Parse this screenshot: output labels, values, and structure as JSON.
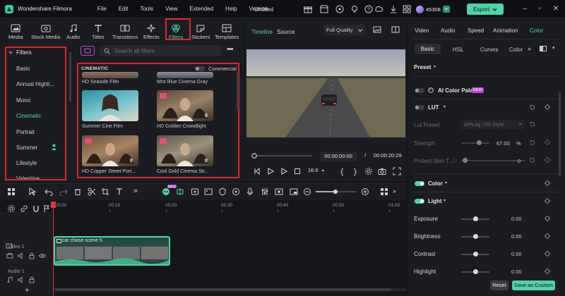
{
  "titlebar": {
    "app_name": "Wondershare Filmora",
    "menu": [
      "File",
      "Edit",
      "Tools",
      "View",
      "Extended",
      "Help",
      "Version"
    ],
    "project_title": "Untitled",
    "credits": "45308",
    "export_label": "Export"
  },
  "media_toolbar": {
    "tabs": [
      {
        "label": "Media",
        "icon": "media-icon"
      },
      {
        "label": "Stock Media",
        "icon": "stock-media-icon"
      },
      {
        "label": "Audio",
        "icon": "music-note-icon"
      },
      {
        "label": "Titles",
        "icon": "text-icon"
      },
      {
        "label": "Transitions",
        "icon": "transitions-icon"
      },
      {
        "label": "Effects",
        "icon": "sparkle-icon"
      },
      {
        "label": "Filters",
        "icon": "filters-icon"
      },
      {
        "label": "Stickers",
        "icon": "sticker-icon"
      },
      {
        "label": "Templates",
        "icon": "templates-icon"
      }
    ],
    "active_tab": "Filters"
  },
  "filters_panel": {
    "header": "Filters",
    "categories": [
      "Basic",
      "Annual Highli...",
      "Mono",
      "Cinematic",
      "Portrait",
      "Summer",
      "Lifestyle",
      "Valentine"
    ],
    "active_category": "Cinematic",
    "search_placeholder": "Search all filters",
    "section_title": "CINEMATIC",
    "commercial_label": "Commercial",
    "items": [
      {
        "label": "HD Seaside Film"
      },
      {
        "label": "Mist Blue Cinema Gray"
      },
      {
        "label": "Summer Cine Film"
      },
      {
        "label": "HD Golden Crowdlight",
        "count": "0"
      },
      {
        "label": "HD Copper Street Port...",
        "count": "0"
      },
      {
        "label": "Cool Gold Cinema Str...",
        "count": "0"
      }
    ]
  },
  "player": {
    "tab_timeline": "Timeline",
    "tab_source": "Source",
    "quality": "Full Quality",
    "current_time": "00:00:00:00",
    "separator": "/",
    "total_time": "00:00:20:29",
    "aspect_ratio": "16:9"
  },
  "right_panel": {
    "tabs": [
      "Video",
      "Audio",
      "Speed",
      "Animation",
      "Color"
    ],
    "active_tab": "Color",
    "subtabs": [
      "Basic",
      "HSL",
      "Curves",
      "Color"
    ],
    "active_subtab": "Basic",
    "preset_label": "Preset",
    "ai_palette_label": "AI Color Palette",
    "ai_palette_badge": "NEW",
    "lut_label": "LUT",
    "lut_preset_label": "Lut Preset",
    "lut_preset_value": "GPLog 709 Style",
    "strength_label": "Strength",
    "strength_value": "67.00",
    "strength_unit": "%",
    "protect_skin_label": "Protect Skin T...",
    "protect_skin_value": "0",
    "color_label": "Color",
    "light_label": "Light",
    "sliders": [
      {
        "label": "Exposure",
        "value": "0.00"
      },
      {
        "label": "Brightness",
        "value": "0.00"
      },
      {
        "label": "Contrast",
        "value": "0.00"
      },
      {
        "label": "Highlight",
        "value": "0.00"
      }
    ],
    "reset_label": "Reset",
    "save_custom_label": "Save as Custom"
  },
  "timeline": {
    "ruler": [
      "00:00",
      "00:10",
      "00:20",
      "00:30",
      "00:40",
      "00:50",
      "01:00"
    ],
    "clip_title": "car chase scene 5",
    "track_video": "Video 1",
    "track_audio": "Audio 1"
  },
  "colors": {
    "accent": "#4fd3a8",
    "highlight_box": "#d9262c",
    "playhead": "#e2343f"
  }
}
